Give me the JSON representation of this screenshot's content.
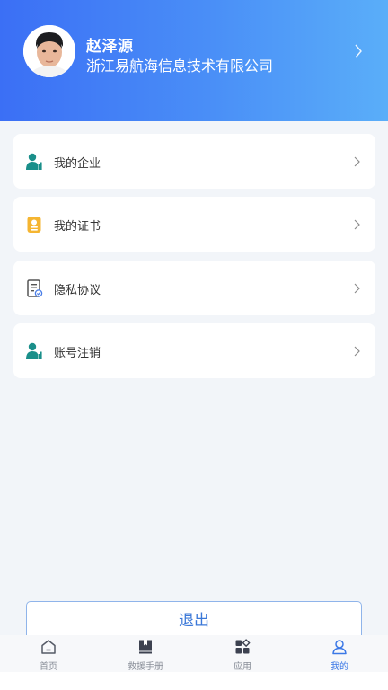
{
  "profile": {
    "name": "赵泽源",
    "company": "浙江易航海信息技术有限公司"
  },
  "menu": [
    {
      "label": "我的企业",
      "icon": "enterprise-user-icon"
    },
    {
      "label": "我的证书",
      "icon": "certificate-icon"
    },
    {
      "label": "隐私协议",
      "icon": "privacy-document-icon"
    },
    {
      "label": "账号注销",
      "icon": "account-user-icon"
    }
  ],
  "logout_label": "退出",
  "tabs": [
    {
      "label": "首页",
      "icon": "home-icon",
      "active": false
    },
    {
      "label": "救援手册",
      "icon": "manual-book-icon",
      "active": false
    },
    {
      "label": "应用",
      "icon": "apps-icon",
      "active": false
    },
    {
      "label": "我的",
      "icon": "profile-icon",
      "active": true
    }
  ],
  "colors": {
    "header_start": "#3b6ff5",
    "header_end": "#5aaef9",
    "accent": "#3b78e6",
    "teal_icon": "#1a8f8a",
    "amber_icon": "#f5b531"
  }
}
